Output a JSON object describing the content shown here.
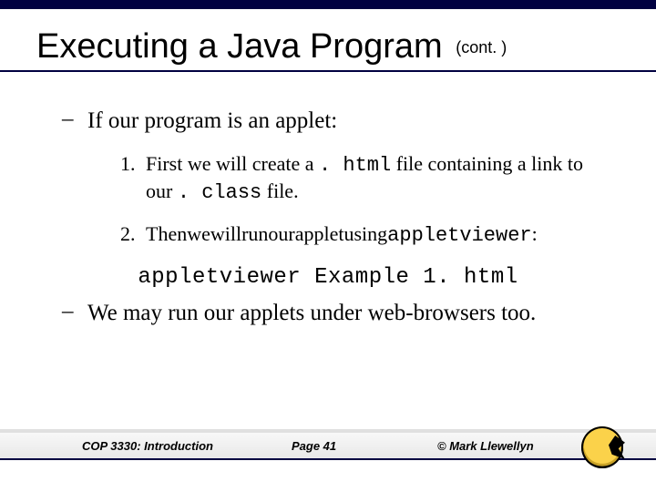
{
  "title": {
    "main": "Executing a Java Program",
    "cont": "(cont. )"
  },
  "bullets": {
    "b1": {
      "dash": "–",
      "text": "If our program is an applet:"
    },
    "b2": {
      "dash": "–",
      "text": "We may run our applets under web-browsers too."
    }
  },
  "steps": {
    "s1": {
      "num": "1.",
      "pre": "First we will create a ",
      "code1": ". html",
      "mid": " file containing a link to our ",
      "code2": ". class",
      "post": " file."
    },
    "s2": {
      "num": "2.",
      "pre": "Thenwewillrunourappletusing",
      "code": "appletviewer",
      "post": ":"
    }
  },
  "command": "appletviewer Example 1. html",
  "footer": {
    "left": "COP 3330:  Introduction",
    "center": "Page 41",
    "right": "© Mark Llewellyn"
  }
}
